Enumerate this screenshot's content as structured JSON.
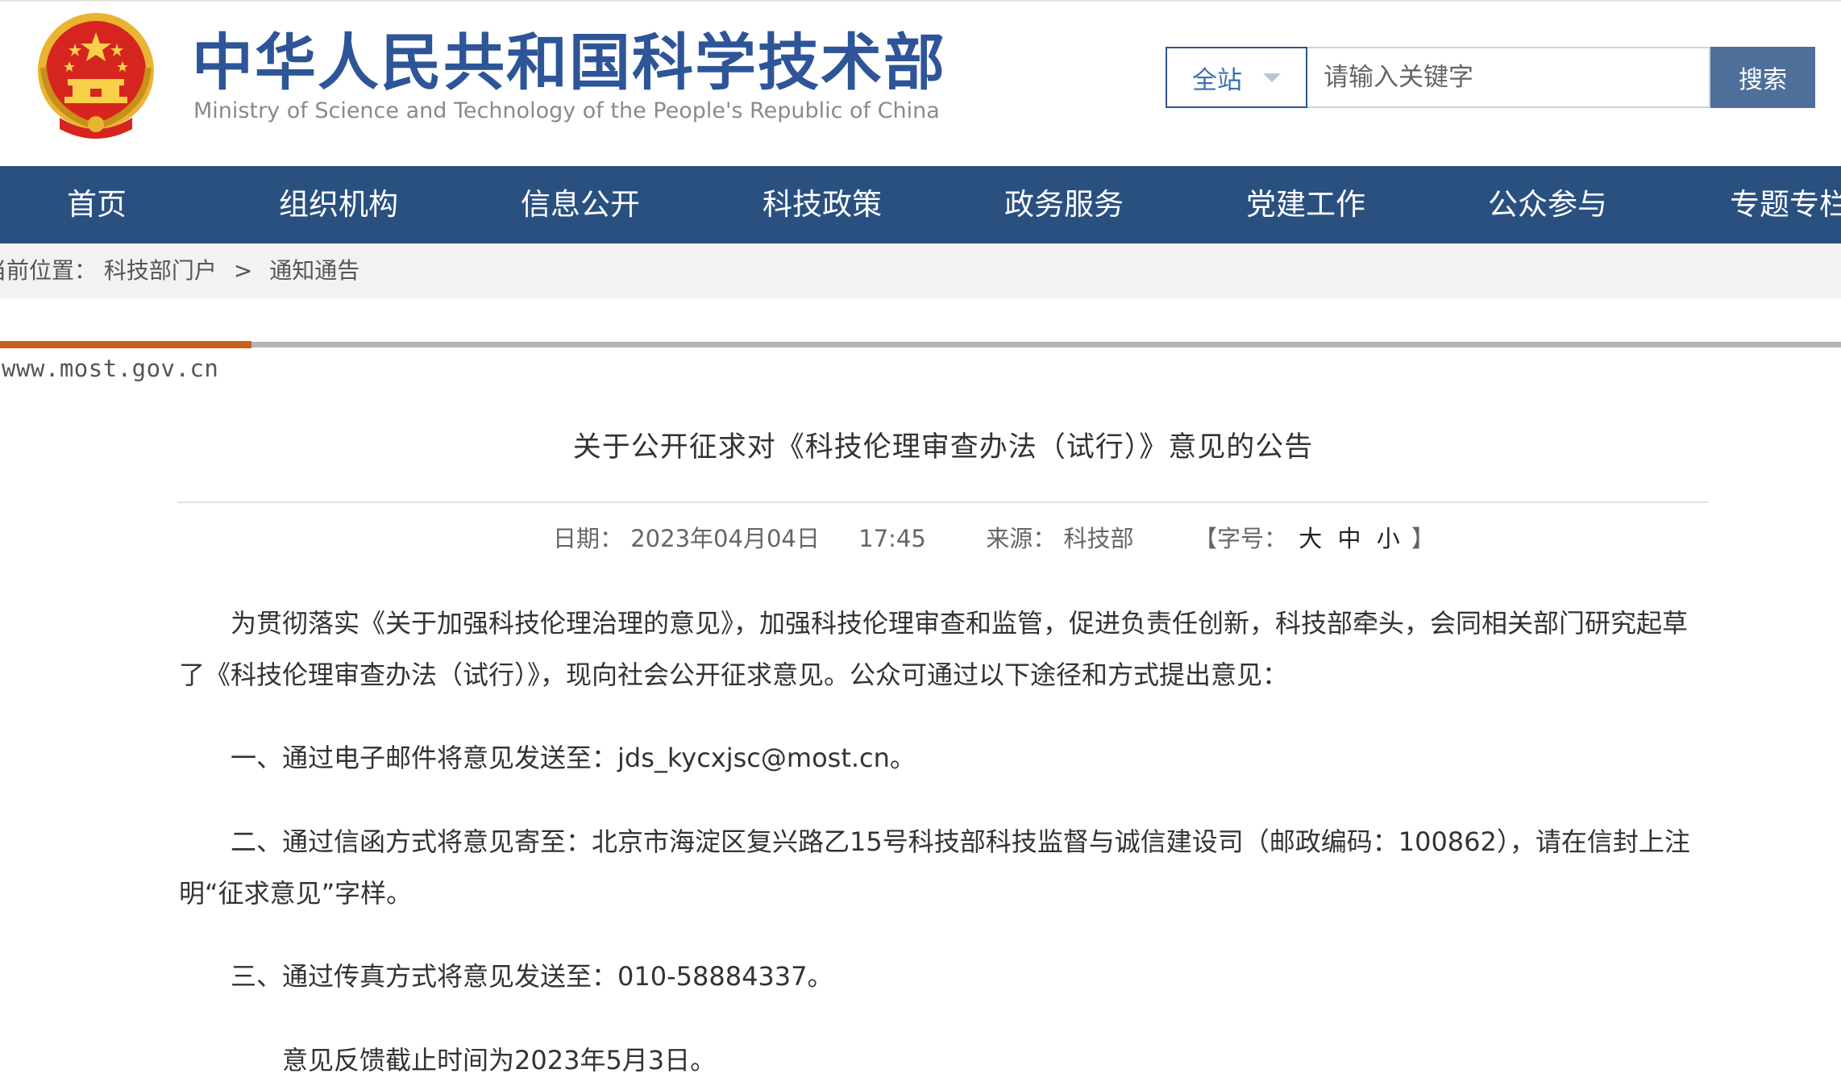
{
  "header": {
    "site_title": "中华人民共和国科学技术部",
    "site_subtitle": "Ministry of Science and Technology of the People's Republic of China",
    "colors": {
      "brand_blue": "#2d5597",
      "nav_blue": "#2a5080",
      "accent_orange": "#c8601a"
    }
  },
  "search": {
    "scope_label": "全站",
    "placeholder": "请输入关键字",
    "button_label": "搜索"
  },
  "nav": {
    "items": [
      {
        "label": "首页"
      },
      {
        "label": "组织机构"
      },
      {
        "label": "信息公开"
      },
      {
        "label": "科技政策"
      },
      {
        "label": "政务服务"
      },
      {
        "label": "党建工作"
      },
      {
        "label": "公众参与"
      },
      {
        "label": "专题专栏"
      }
    ]
  },
  "breadcrumb": {
    "prefix": "当前位置：",
    "items": [
      {
        "label": "科技部门户"
      },
      {
        "label": "通知通告"
      }
    ],
    "separator": ">"
  },
  "domain_mark": "www.most.gov.cn",
  "article": {
    "title": "关于公开征求对《科技伦理审查办法（试行）》意见的公告",
    "meta": {
      "date_label": "日期：",
      "date": "2023年04月04日",
      "time": "17:45",
      "source_label": "来源：",
      "source": "科技部",
      "font_size_label": "【字号：",
      "font_large": "大",
      "font_medium": "中",
      "font_small": "小",
      "font_size_close": "】"
    },
    "paragraphs": [
      "为贯彻落实《关于加强科技伦理治理的意见》，加强科技伦理审查和监管，促进负责任创新，科技部牵头，会同相关部门研究起草了《科技伦理审查办法（试行）》，现向社会公开征求意见。公众可通过以下途径和方式提出意见：",
      "一、通过电子邮件将意见发送至：jds_kycxjsc@most.cn。",
      "二、通过信函方式将意见寄至：北京市海淀区复兴路乙15号科技部科技监督与诚信建设司（邮政编码：100862），请在信封上注明“征求意见”字样。",
      "三、通过传真方式将意见发送至：010-58884337。",
      "意见反馈截止时间为2023年5月3日。"
    ]
  }
}
